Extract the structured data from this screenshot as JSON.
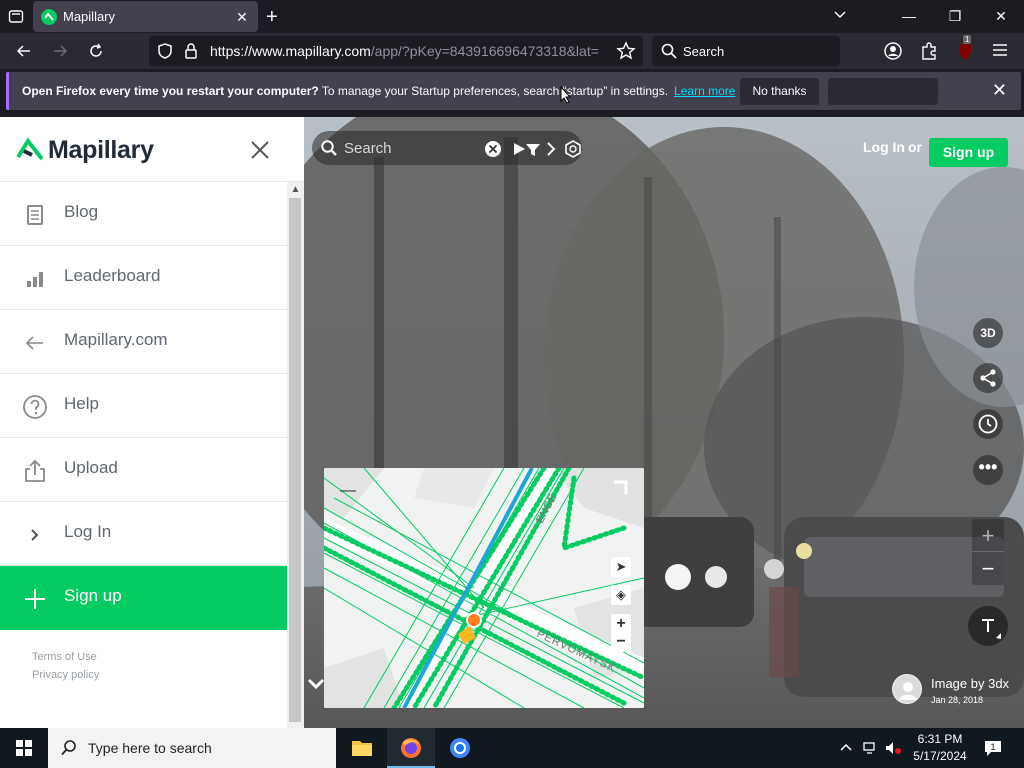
{
  "browser": {
    "tab_title": "Mapillary",
    "url_host": "https://www.mapillary.com",
    "url_path": "/app/?pKey=843916696473318&lat=",
    "search_label": "Search",
    "ext_badge": "1"
  },
  "notification": {
    "bold": "Open Firefox every time you restart your computer?",
    "text": " To manage your Startup preferences, search “startup” in settings.",
    "link": "Learn more",
    "no_thanks": "No thanks"
  },
  "sidebar": {
    "brand": "Mapillary",
    "items": [
      {
        "label": "Blog",
        "icon": "document-icon"
      },
      {
        "label": "Leaderboard",
        "icon": "bar-chart-icon"
      },
      {
        "label": "Mapillary.com",
        "icon": "arrow-left-icon"
      },
      {
        "label": "Help",
        "icon": "question-icon"
      },
      {
        "label": "Upload",
        "icon": "upload-icon"
      },
      {
        "label": "Log In",
        "icon": "chevron-right-icon"
      },
      {
        "label": "Sign up",
        "icon": "plus-icon"
      }
    ],
    "footer": {
      "terms": "Terms of Use",
      "privacy": "Privacy policy"
    }
  },
  "viewer": {
    "search_placeholder": "Search",
    "login": "Log In",
    "or": "or",
    "signup": "Sign up",
    "btn_3d": "3D",
    "image_by": "Image by 3dx",
    "image_date": "Jan 28, 2018"
  },
  "minimap": {
    "street_1": "ENGE",
    "street_2": "PERVOMAYSK"
  },
  "taskbar": {
    "search_placeholder": "Type here to search",
    "time": "6:31 PM",
    "date": "5/17/2024"
  },
  "colors": {
    "brand_green": "#05cb63",
    "firefox_dark": "#1c1b22",
    "notif_accent": "#a66cff"
  }
}
